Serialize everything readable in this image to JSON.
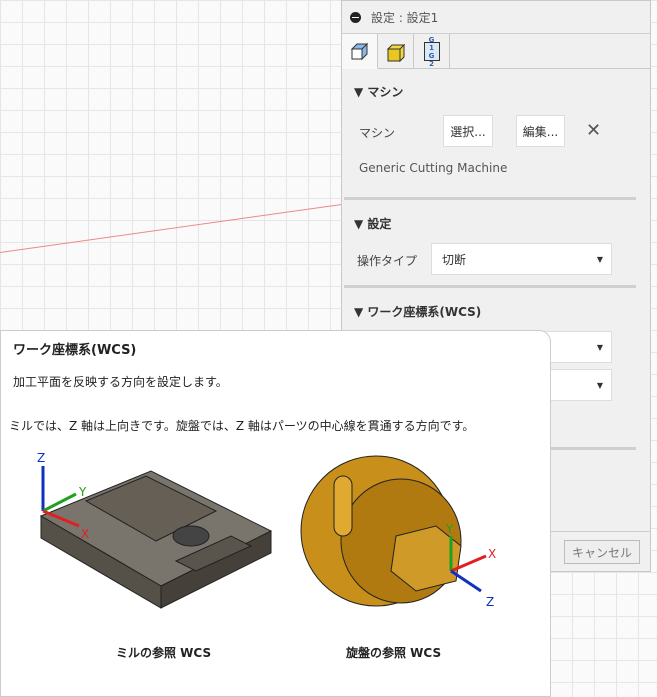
{
  "panel": {
    "title": "設定 : 設定1",
    "tabs": [
      {
        "icon": "setup-icon"
      },
      {
        "icon": "stock-icon"
      },
      {
        "icon": "post-process-icon",
        "text": "G1G2"
      }
    ],
    "machine_section": "▼ マシン",
    "machine_label": "マシン",
    "select_button": "選択...",
    "edit_button": "編集...",
    "machine_name": "Generic Cutting Machine",
    "settings_section": "▼ 設定",
    "operation_type_label": "操作タイプ",
    "operation_type_value": "切断",
    "wcs_section": "▼ ワーク座標系(WCS)",
    "cancel_button": "キャンセル"
  },
  "tooltip": {
    "title": "ワーク座標系(WCS)",
    "line1": "加工平面を反映する方向を設定します。",
    "line2": "ミルでは、Z 軸は上向きです。旋盤では、Z 軸はパーツの中心線を貫通する方向です。",
    "mill_caption": "ミルの参照 WCS",
    "lathe_caption": "旋盤の参照 WCS",
    "axes": {
      "x": "X",
      "y": "Y",
      "z": "Z"
    }
  },
  "colors": {
    "x_axis": "#e02020",
    "y_axis": "#20a020",
    "z_axis": "#1030c0"
  }
}
